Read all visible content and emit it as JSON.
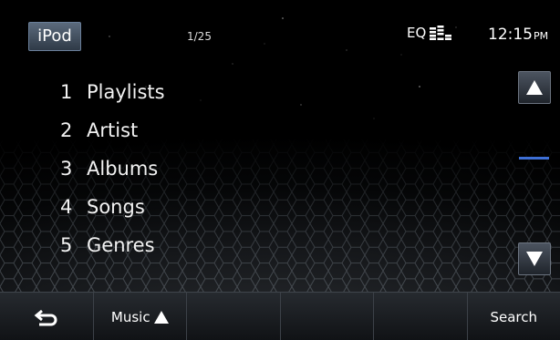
{
  "topbar": {
    "source_label": "iPod",
    "track_position": "1/25",
    "eq_label": "EQ",
    "eq_icon": "equalizer-bars-icon",
    "time": "12:15",
    "ampm": "PM"
  },
  "menu": {
    "items": [
      {
        "num": "1",
        "label": "Playlists"
      },
      {
        "num": "2",
        "label": "Artist"
      },
      {
        "num": "3",
        "label": "Albums"
      },
      {
        "num": "4",
        "label": "Songs"
      },
      {
        "num": "5",
        "label": "Genres"
      }
    ]
  },
  "scroll": {
    "up_icon": "arrow-up-icon",
    "down_icon": "arrow-down-icon"
  },
  "bottombar": {
    "back_icon": "return-arrow-icon",
    "music_label": "Music",
    "music_icon": "triangle-up-icon",
    "search_label": "Search"
  },
  "colors": {
    "accent": "#3d6fd6",
    "button_border": "#6a7f9a"
  }
}
